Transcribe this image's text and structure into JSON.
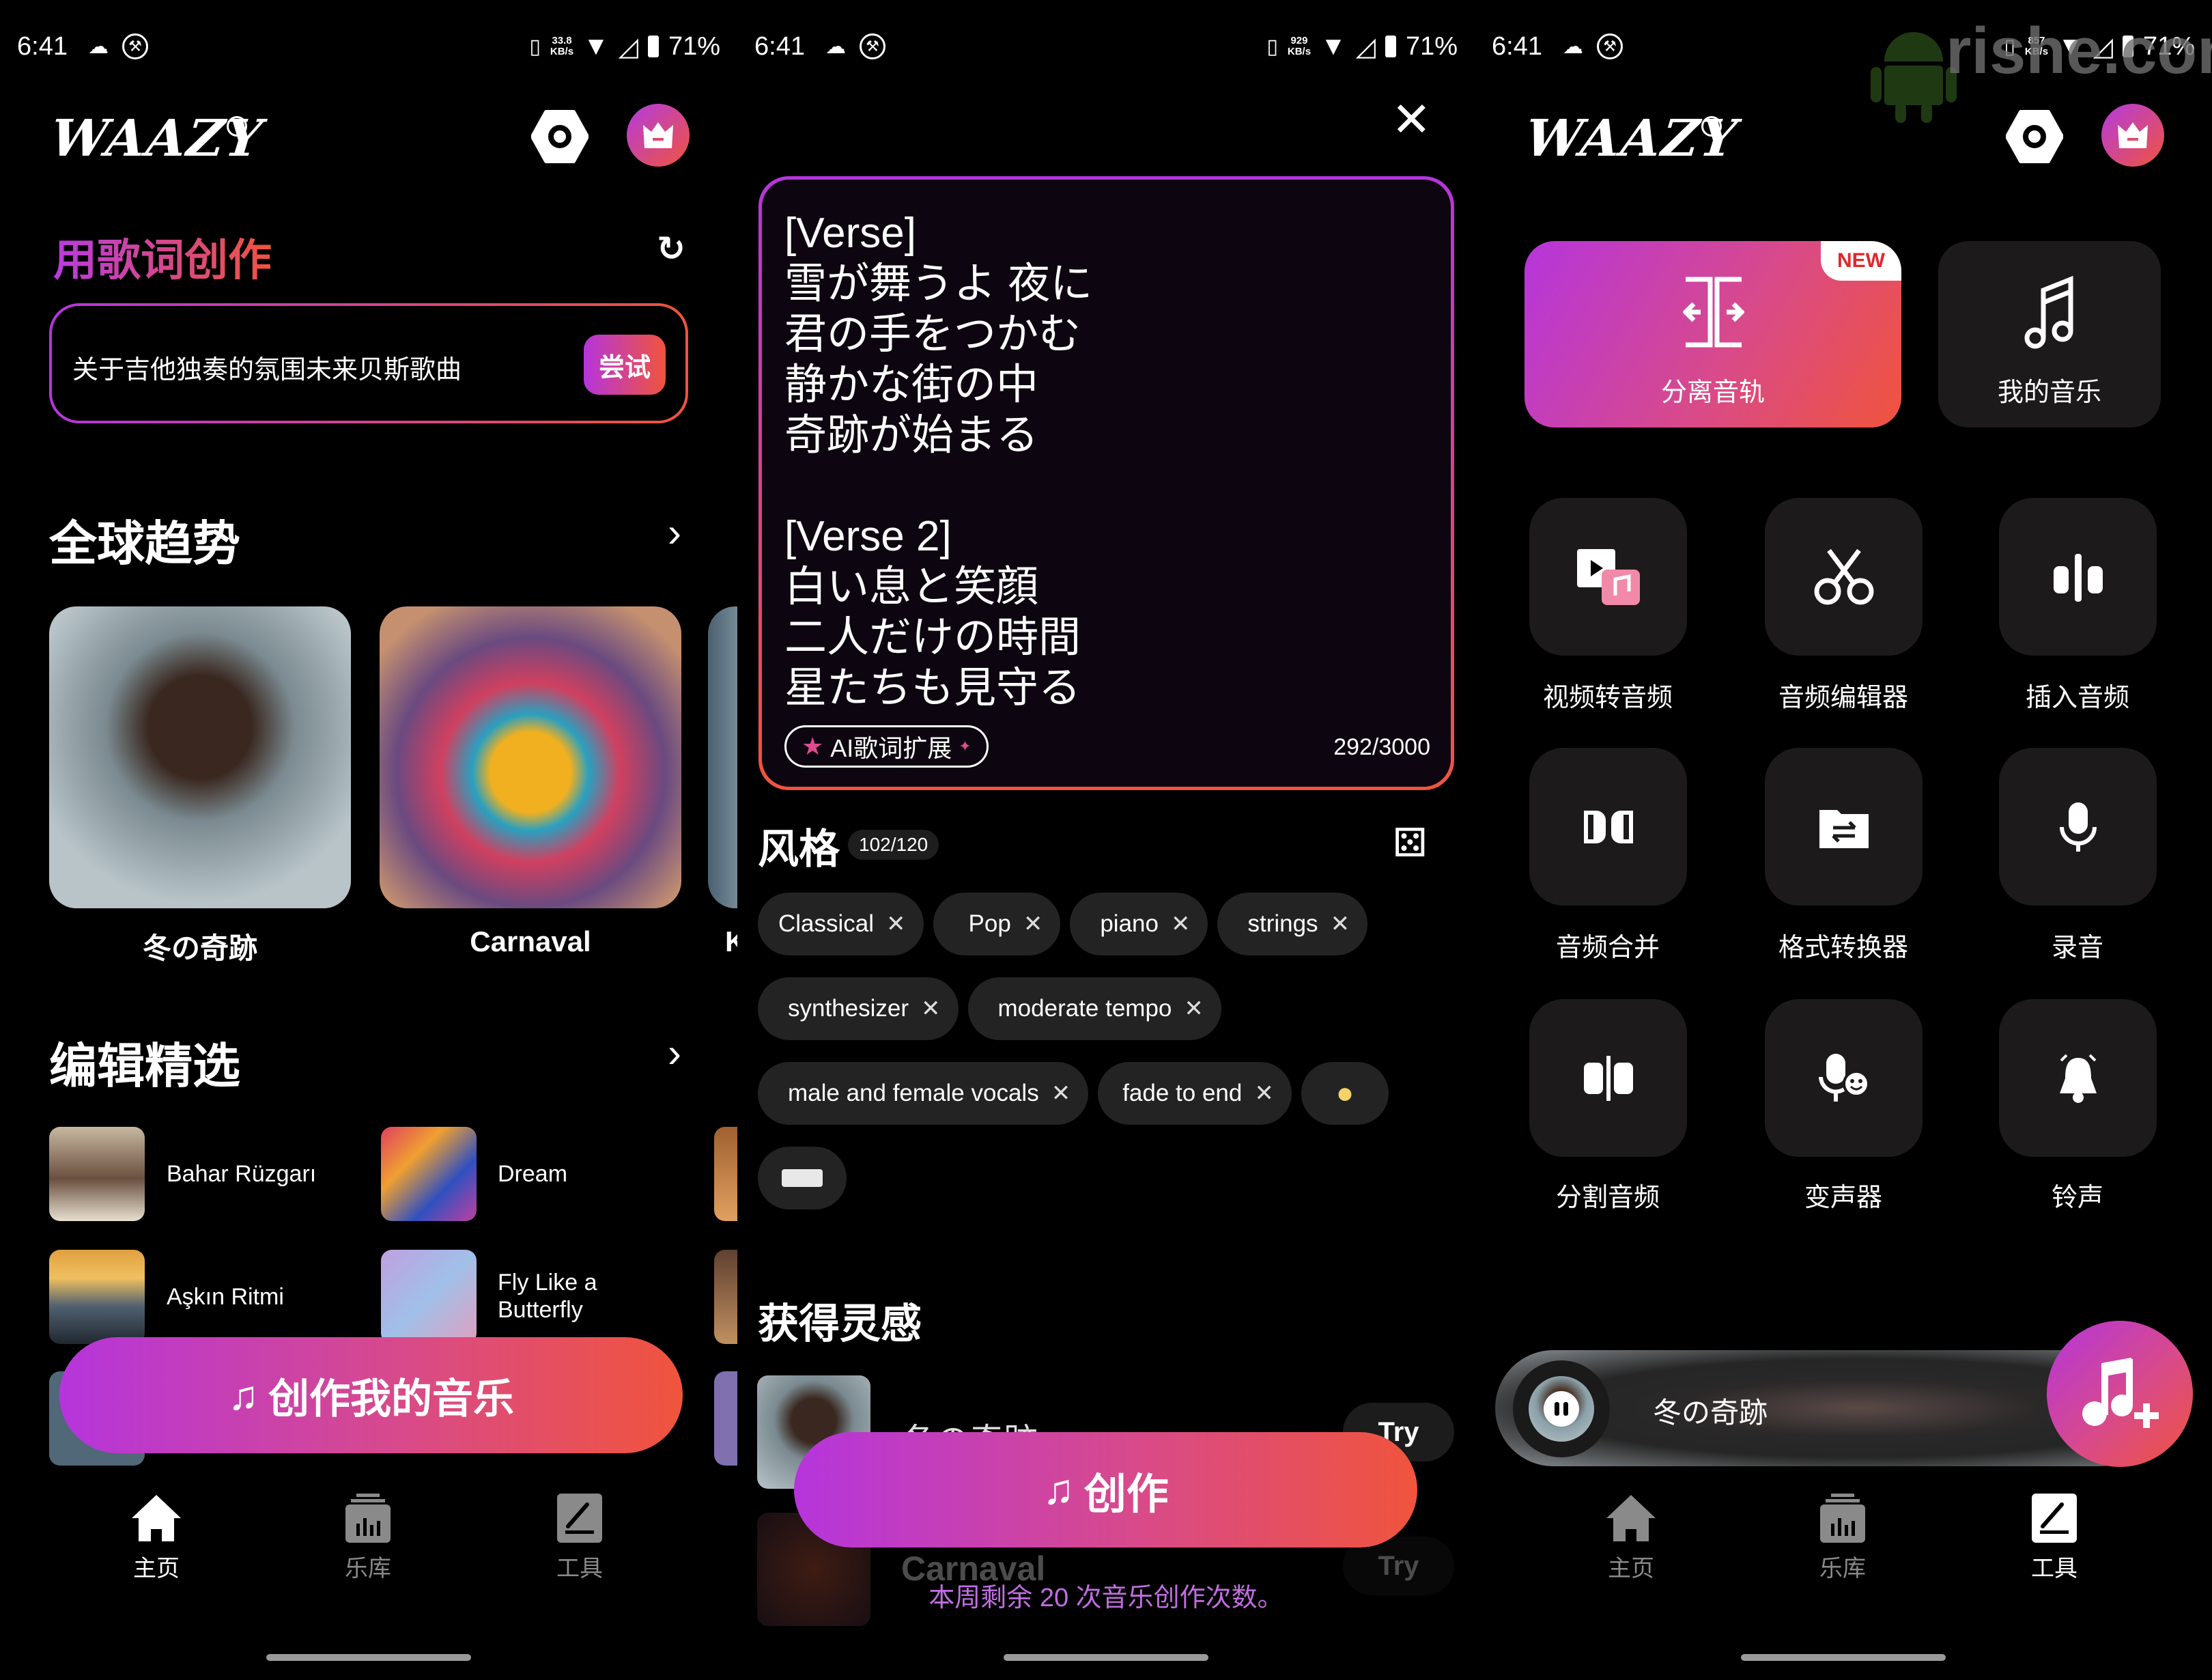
{
  "status_bars": [
    {
      "time": "6:41",
      "speed": "33.8",
      "speed_unit": "KB/s",
      "battery": "71%"
    },
    {
      "time": "6:41",
      "speed": "929",
      "speed_unit": "KB/s",
      "battery": "71%"
    },
    {
      "time": "6:41",
      "speed": "857",
      "speed_unit": "KB/s",
      "battery": "71%"
    }
  ],
  "app": {
    "logo": "WAAZY",
    "info_icon": "i",
    "accent_start": "#b535dc",
    "accent_end": "#f0543c"
  },
  "home": {
    "lyrics_title": "用歌词创作",
    "prompt_text": "关于吉他独奏的氛围未来贝斯歌曲",
    "try_label": "尝试",
    "trending_title": "全球趋势",
    "trending": [
      {
        "title": "冬の奇跡"
      },
      {
        "title": "Carnaval"
      },
      {
        "title": "K"
      }
    ],
    "picks_title": "编辑精选",
    "picks": [
      {
        "title": "Bahar Rüzgarı"
      },
      {
        "title": "Dream"
      },
      {
        "title": "Aşkın Ritmi"
      },
      {
        "title": "Fly Like a Butterfly"
      }
    ],
    "create_button": "创作我的音乐"
  },
  "nav": {
    "items": [
      {
        "label": "主页"
      },
      {
        "label": "乐库"
      },
      {
        "label": "工具"
      }
    ]
  },
  "create": {
    "lyrics": [
      "[Verse]",
      "雪が舞うよ 夜に",
      "君の手をつかむ",
      "静かな街の中",
      "奇跡が始まる",
      "",
      "[Verse 2]",
      "白い息と笑顔",
      "二人だけの時間",
      "星たちも見守る"
    ],
    "ai_expand": "AI歌词扩展",
    "char_count": "292/3000",
    "style_title": "风格",
    "style_count": "102/120",
    "tags": [
      "Classical",
      "Pop",
      "piano",
      "strings",
      "synthesizer",
      "moderate tempo",
      "male and female vocals",
      "fade to end"
    ],
    "inspiration_title": "获得灵感",
    "inspirations": [
      {
        "title": "冬の奇跡",
        "try": "Try"
      },
      {
        "title": "Carnaval",
        "try": "Try"
      }
    ],
    "create_button": "创作",
    "remaining": "本周剩余 20 次音乐创作次数。"
  },
  "tools": {
    "watermark": "rishe.com",
    "stem_split": {
      "label": "分离音轨",
      "badge": "NEW"
    },
    "my_music": "我的音乐",
    "grid": [
      {
        "label": "视频转音频",
        "icon": "video-to-audio-icon"
      },
      {
        "label": "音频编辑器",
        "icon": "scissors-icon"
      },
      {
        "label": "插入音频",
        "icon": "insert-audio-icon"
      },
      {
        "label": "音频合并",
        "icon": "merge-audio-icon"
      },
      {
        "label": "格式转换器",
        "icon": "format-convert-icon"
      },
      {
        "label": "录音",
        "icon": "microphone-icon"
      },
      {
        "label": "分割音频",
        "icon": "split-audio-icon"
      },
      {
        "label": "变声器",
        "icon": "voice-changer-icon"
      },
      {
        "label": "铃声",
        "icon": "bell-icon"
      }
    ],
    "player": {
      "title": "冬の奇跡"
    }
  }
}
